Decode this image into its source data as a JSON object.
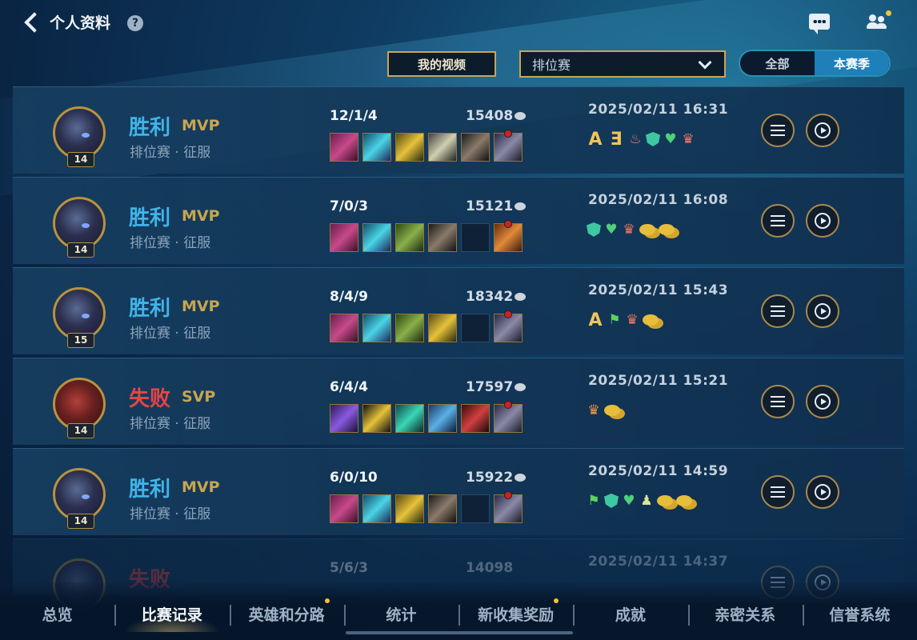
{
  "header": {
    "title": "个人资料",
    "help_glyph": "?"
  },
  "controls": {
    "my_videos": "我的视频",
    "mode_select": "排位赛",
    "season_toggle": {
      "all": "全部",
      "current": "本赛季"
    }
  },
  "matches": [
    {
      "result": "胜利",
      "tag": "MVP",
      "mode": "排位赛 · 征服",
      "level": "14",
      "kda": "12/1/4",
      "gold": "15408",
      "date": "2025/02/11 16:31",
      "outcome": "win"
    },
    {
      "result": "胜利",
      "tag": "MVP",
      "mode": "排位赛 · 征服",
      "level": "14",
      "kda": "7/0/3",
      "gold": "15121",
      "date": "2025/02/11 16:08",
      "outcome": "win"
    },
    {
      "result": "胜利",
      "tag": "MVP",
      "mode": "排位赛 · 征服",
      "level": "15",
      "kda": "8/4/9",
      "gold": "18342",
      "date": "2025/02/11 15:43",
      "outcome": "win"
    },
    {
      "result": "失败",
      "tag": "SVP",
      "mode": "排位赛 · 征服",
      "level": "14",
      "kda": "6/4/4",
      "gold": "17597",
      "date": "2025/02/11 15:21",
      "outcome": "lose"
    },
    {
      "result": "胜利",
      "tag": "MVP",
      "mode": "排位赛 · 征服",
      "level": "14",
      "kda": "6/0/10",
      "gold": "15922",
      "date": "2025/02/11 14:59",
      "outcome": "win"
    },
    {
      "result": "失败",
      "tag": "",
      "mode": "",
      "level": "",
      "kda": "5/6/3",
      "gold": "14098",
      "date": "2025/02/11 14:37",
      "outcome": "lose"
    }
  ],
  "badges": {
    "row1_a": "A",
    "row1_b": "Ǝ",
    "row3_a": "A"
  },
  "nav": {
    "tabs": [
      "总览",
      "比赛记录",
      "英雄和分路",
      "统计",
      "新收集奖励",
      "成就",
      "亲密关系",
      "信誉系统"
    ],
    "active": "比赛记录"
  },
  "colors": {
    "win": "#3fb4e8",
    "lose": "#e84545",
    "gold_accent": "#c9a54e",
    "segment_active": "#1f7fb8"
  }
}
